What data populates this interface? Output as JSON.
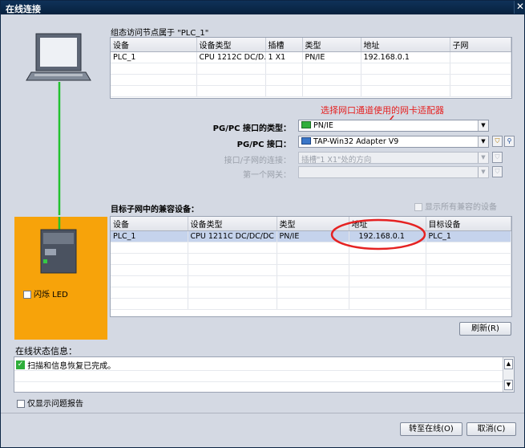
{
  "window": {
    "title": "在线连接",
    "close_glyph": "✕"
  },
  "top_section": {
    "heading": "组态访问节点属于 \"PLC_1\"",
    "columns": [
      "设备",
      "设备类型",
      "插槽",
      "类型",
      "地址",
      "子网"
    ],
    "rows": [
      [
        "PLC_1",
        "CPU 1212C DC/D...",
        "1 X1",
        "PN/IE",
        "192.168.0.1",
        ""
      ]
    ]
  },
  "annotation": {
    "text": "选择网口通道使用的网卡适配器",
    "color": "#e52222"
  },
  "form": {
    "pgpc_type_label": "PG/PC 接口的类型：",
    "pgpc_type_value": "PN/IE",
    "pgpc_if_label": "PG/PC 接口：",
    "pgpc_if_value": "TAP-Win32 Adapter V9",
    "subnet_conn_label": "接口/子网的连接：",
    "subnet_conn_value": "插槽\"1 X1\"处的方向",
    "gateway_label": "第一个网关：",
    "gateway_value": ""
  },
  "target_section": {
    "heading": "目标子网中的兼容设备：",
    "show_all_label": "显示所有兼容的设备",
    "columns": [
      "设备",
      "设备类型",
      "类型",
      "地址",
      "目标设备"
    ],
    "rows": [
      [
        "PLC_1",
        "CPU 1211C DC/DC/DC",
        "PN/IE",
        "192.168.0.1",
        "PLC_1"
      ]
    ]
  },
  "flash_led_label": "闪烁 LED",
  "refresh_label": "刷新(R)",
  "status": {
    "heading": "在线状态信息：",
    "message": "扫描和信息恢复已完成。",
    "only_problems_label": "仅显示问题报告"
  },
  "buttons": {
    "go_online": "转至在线(O)",
    "cancel": "取消(C)"
  },
  "colors": {
    "device_panel": "#f7a30a",
    "link_line": "#22c22e",
    "highlight": "#c5d3ec"
  }
}
